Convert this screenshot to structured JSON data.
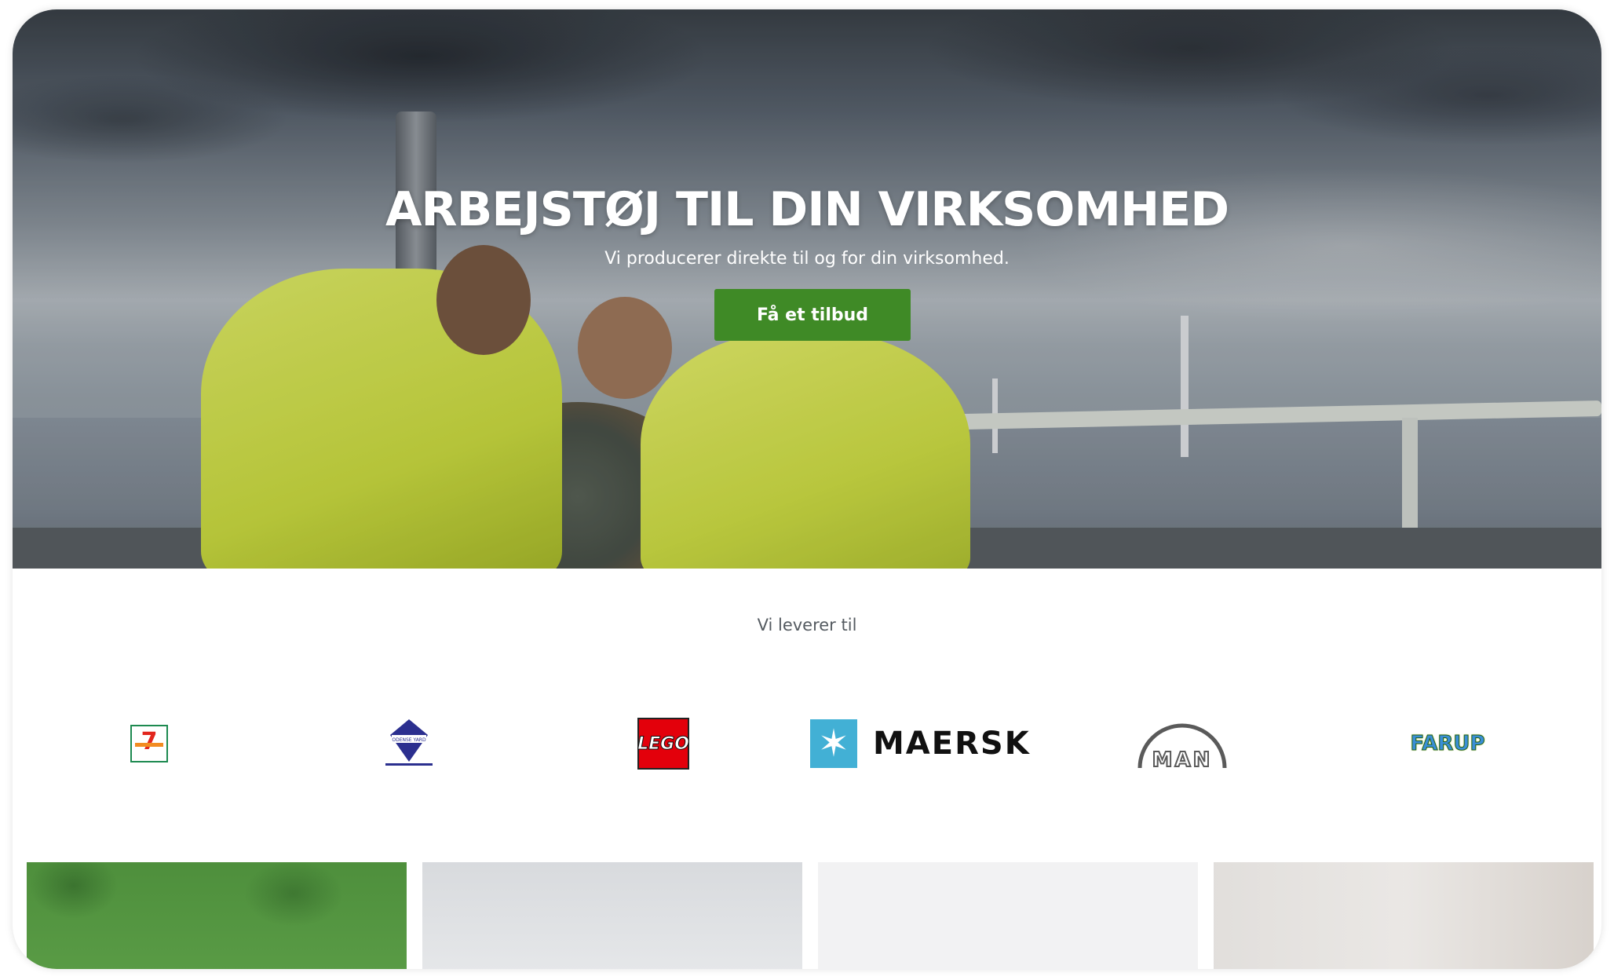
{
  "hero": {
    "title": "ARBEJSTØJ TIL DIN VIRKSOMHED",
    "subtitle": "Vi producerer direkte til og for din virksomhed.",
    "cta_label": "Få et tilbud",
    "cta_color": "#3f8a26"
  },
  "suppliers": {
    "label": "Vi leverer til",
    "logos": [
      {
        "name": "7-Eleven",
        "mark": "7"
      },
      {
        "name": "Odense Staalskibsværft",
        "mark": "ODENSE YARD"
      },
      {
        "name": "LEGO",
        "mark": "LEGO"
      },
      {
        "name": "Maersk",
        "mark": "MAERSK"
      },
      {
        "name": "MAN",
        "mark": "MAN"
      },
      {
        "name": "Fårup Sommerland",
        "mark": "FARUP"
      }
    ]
  },
  "colors": {
    "accent_green": "#3f8a26",
    "maersk_blue": "#42b0d5",
    "lego_red": "#e3000b"
  }
}
